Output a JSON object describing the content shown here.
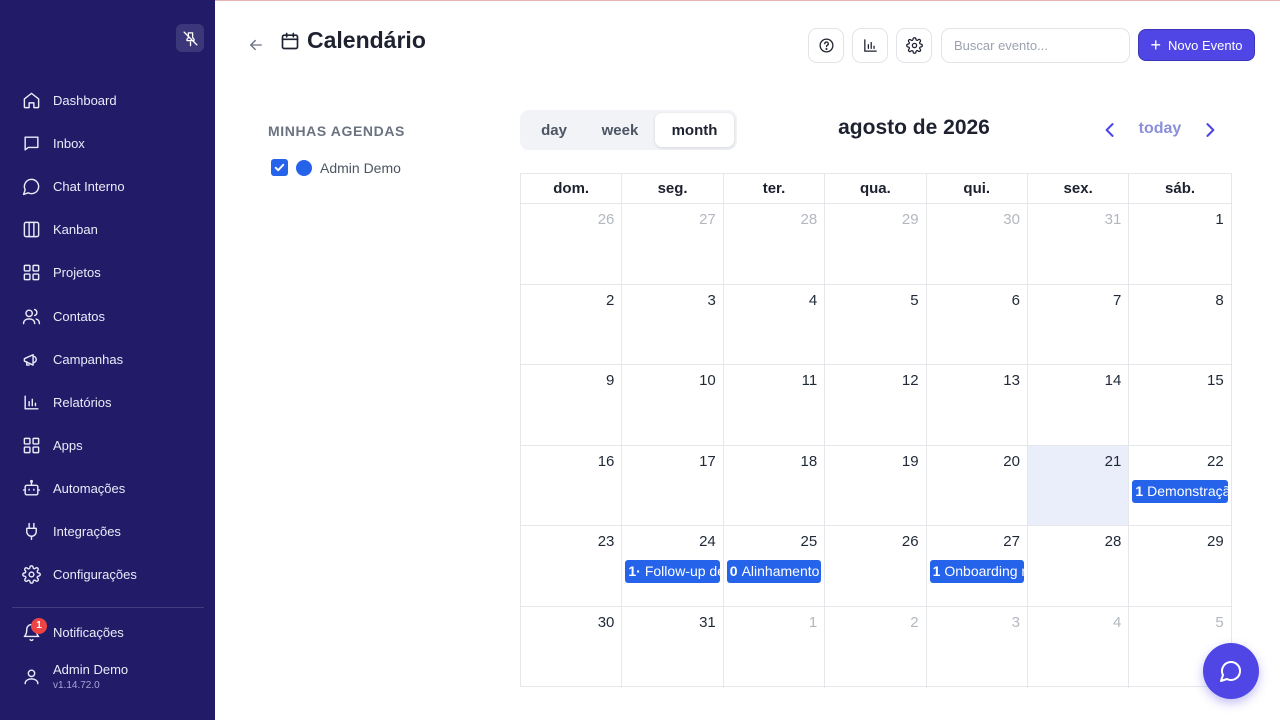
{
  "sidebar": {
    "items": [
      {
        "label": "Dashboard",
        "icon": "home-icon"
      },
      {
        "label": "Inbox",
        "icon": "inbox-icon"
      },
      {
        "label": "Chat Interno",
        "icon": "chat-icon"
      },
      {
        "label": "Kanban",
        "icon": "kanban-icon"
      },
      {
        "label": "Projetos",
        "icon": "projects-icon"
      },
      {
        "label": "Contatos",
        "icon": "contacts-icon"
      },
      {
        "label": "Campanhas",
        "icon": "megaphone-icon"
      },
      {
        "label": "Relatórios",
        "icon": "reports-icon"
      },
      {
        "label": "Apps",
        "icon": "apps-icon"
      },
      {
        "label": "Automações",
        "icon": "bot-icon"
      },
      {
        "label": "Integrações",
        "icon": "plug-icon"
      },
      {
        "label": "Configurações",
        "icon": "gear-icon"
      }
    ],
    "notifications": {
      "label": "Notificações",
      "count": "1"
    },
    "user": {
      "name": "Admin Demo",
      "version": "v1.14.72.0"
    }
  },
  "header": {
    "title": "Calendário",
    "search_placeholder": "Buscar evento...",
    "new_event_label": "Novo Evento"
  },
  "agendas": {
    "title": "MINHAS AGENDAS",
    "items": [
      {
        "label": "Admin Demo",
        "checked": true,
        "color": "#2563eb"
      }
    ]
  },
  "calendar": {
    "views": [
      "day",
      "week",
      "month"
    ],
    "active_view": "month",
    "title": "agosto de 2026",
    "today_label": "today",
    "weekdays": [
      "dom.",
      "seg.",
      "ter.",
      "qua.",
      "qui.",
      "sex.",
      "sáb."
    ],
    "weeks": [
      [
        {
          "d": "26",
          "o": true
        },
        {
          "d": "27",
          "o": true
        },
        {
          "d": "28",
          "o": true
        },
        {
          "d": "29",
          "o": true
        },
        {
          "d": "30",
          "o": true
        },
        {
          "d": "31",
          "o": true
        },
        {
          "d": "1"
        }
      ],
      [
        {
          "d": "2"
        },
        {
          "d": "3"
        },
        {
          "d": "4"
        },
        {
          "d": "5"
        },
        {
          "d": "6"
        },
        {
          "d": "7"
        },
        {
          "d": "8"
        }
      ],
      [
        {
          "d": "9"
        },
        {
          "d": "10"
        },
        {
          "d": "11"
        },
        {
          "d": "12"
        },
        {
          "d": "13"
        },
        {
          "d": "14"
        },
        {
          "d": "15"
        }
      ],
      [
        {
          "d": "16"
        },
        {
          "d": "17"
        },
        {
          "d": "18"
        },
        {
          "d": "19"
        },
        {
          "d": "20"
        },
        {
          "d": "21",
          "today": true
        },
        {
          "d": "22",
          "event": {
            "time": "1",
            "title": "Demonstraçã"
          }
        }
      ],
      [
        {
          "d": "23"
        },
        {
          "d": "24",
          "event": {
            "time": "1·",
            "title": "Follow-up de"
          }
        },
        {
          "d": "25",
          "event": {
            "time": "0",
            "title": "Alinhamento"
          }
        },
        {
          "d": "26"
        },
        {
          "d": "27",
          "event": {
            "time": "1",
            "title": "Onboarding n"
          }
        },
        {
          "d": "28"
        },
        {
          "d": "29"
        }
      ],
      [
        {
          "d": "30"
        },
        {
          "d": "31"
        },
        {
          "d": "1",
          "o": true
        },
        {
          "d": "2",
          "o": true
        },
        {
          "d": "3",
          "o": true
        },
        {
          "d": "4",
          "o": true
        },
        {
          "d": "5",
          "o": true
        }
      ]
    ]
  },
  "colors": {
    "sidebar_bg": "#221c68",
    "accent": "#4f46e5",
    "event": "#2563eb",
    "today_bg": "#eaeefb"
  }
}
